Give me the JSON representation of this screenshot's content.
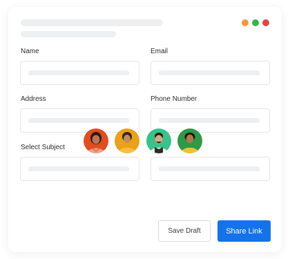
{
  "window": {
    "dots": [
      {
        "name": "orange-dot",
        "color": "#f59a3b"
      },
      {
        "name": "green-dot",
        "color": "#3ab54a"
      },
      {
        "name": "red-dot",
        "color": "#e8453c"
      }
    ]
  },
  "form": {
    "fields": {
      "name": {
        "label": "Name"
      },
      "email": {
        "label": "Email"
      },
      "address": {
        "label": "Address"
      },
      "phone": {
        "label": "Phone Number"
      },
      "subject": {
        "label": "Select Subject"
      }
    }
  },
  "collaborators": [
    {
      "name": "collaborator-avatar-1",
      "bg": "#e24d1e"
    },
    {
      "name": "collaborator-avatar-2",
      "bg": "#eaa21a"
    },
    {
      "name": "collaborator-avatar-3",
      "bg": "#37c38a"
    },
    {
      "name": "collaborator-avatar-4",
      "bg": "#2e9a45"
    }
  ],
  "actions": {
    "save_draft_label": "Save Draft",
    "share_link_label": "Share Link"
  },
  "colors": {
    "accent": "#1473ea"
  }
}
